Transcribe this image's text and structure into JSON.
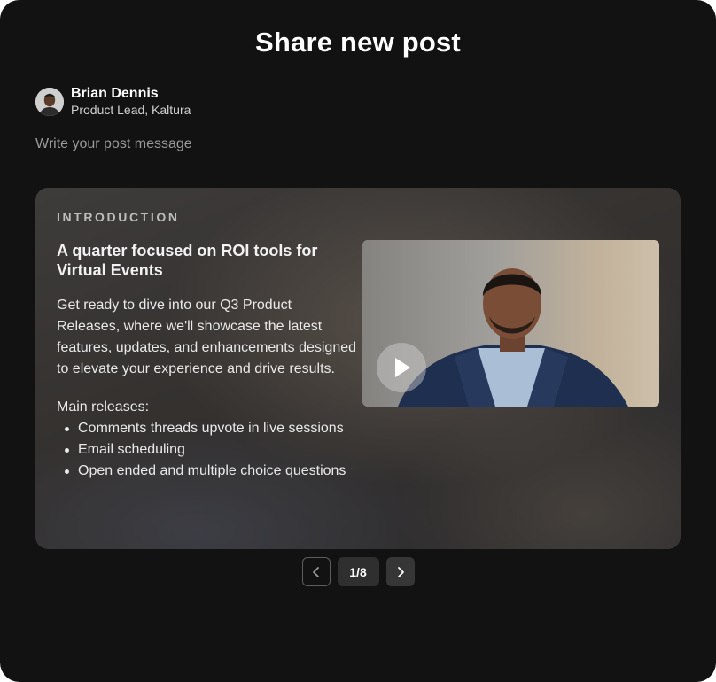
{
  "dialog": {
    "title": "Share new post"
  },
  "author": {
    "name": "Brian Dennis",
    "role": "Product Lead, Kaltura",
    "avatar_icon": "person-avatar"
  },
  "composer": {
    "placeholder": "Write your post message",
    "value": ""
  },
  "card": {
    "eyebrow": "INTRODUCTION",
    "heading": "A quarter focused on ROI tools for Virtual Events",
    "body": "Get ready to dive into our Q3 Product Releases, where we'll showcase the latest features, updates, and enhancements designed to elevate your experience and drive results.",
    "releases_label": "Main releases:",
    "releases": [
      "Comments threads upvote in live sessions",
      "Email scheduling",
      "Open ended and multiple choice questions"
    ],
    "video": {
      "play_icon": "play-icon"
    }
  },
  "pager": {
    "current_label": "1/8",
    "prev_icon": "chevron-left-icon",
    "next_icon": "chevron-right-icon"
  },
  "colors": {
    "modal_background": "#121212",
    "card_background": "#3a3837",
    "pager_active": "#2f2f2f"
  }
}
